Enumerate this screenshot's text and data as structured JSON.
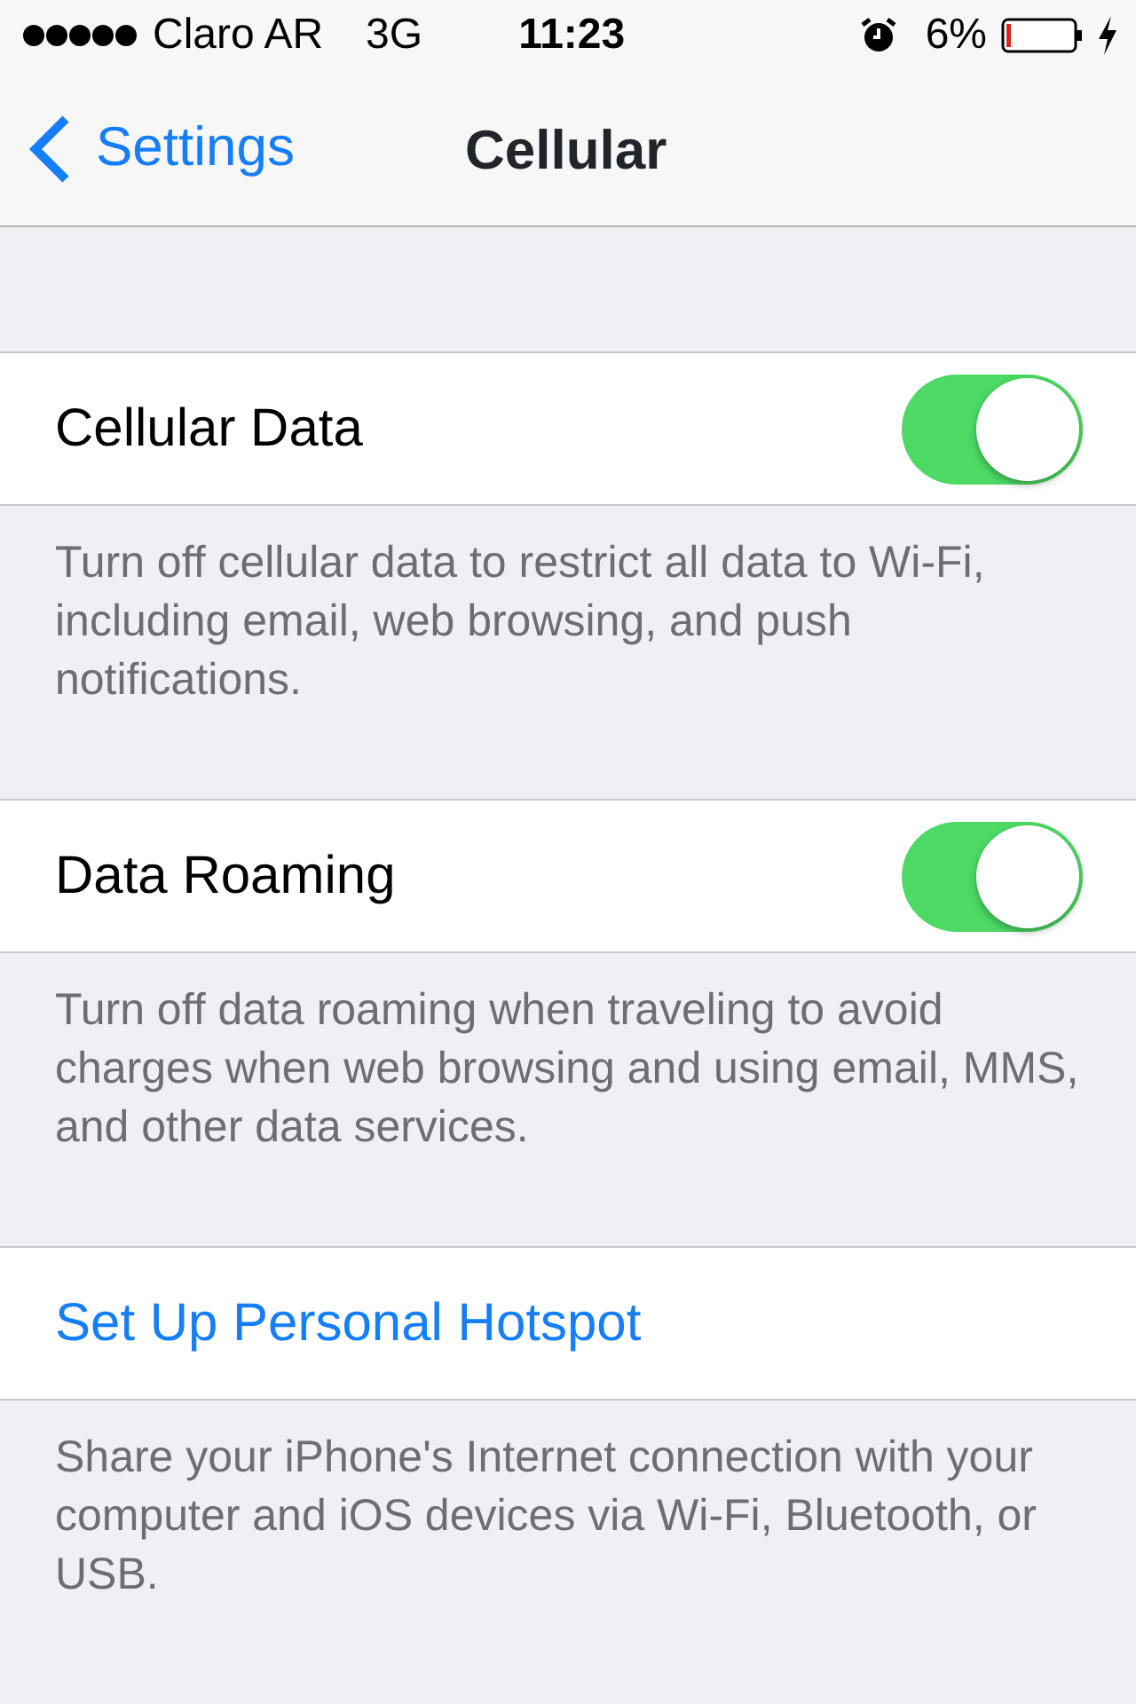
{
  "status_bar": {
    "carrier": "Claro AR",
    "network": "3G",
    "time": "11:23",
    "battery": "6%"
  },
  "nav": {
    "back": "Settings",
    "title": "Cellular"
  },
  "sections": [
    {
      "kind": "toggle",
      "label": "Cellular Data",
      "on": true,
      "footer": "Turn off cellular data to restrict all data to Wi-Fi, including email, web browsing, and push notifications."
    },
    {
      "kind": "toggle",
      "label": "Data Roaming",
      "on": true,
      "footer": "Turn off data roaming when traveling to avoid charges when web browsing and using email, MMS, and other data services."
    },
    {
      "kind": "link",
      "label": "Set Up Personal Hotspot",
      "footer": "Share your iPhone's Internet connection with your computer and iOS devices via Wi-Fi, Bluetooth, or USB."
    }
  ]
}
